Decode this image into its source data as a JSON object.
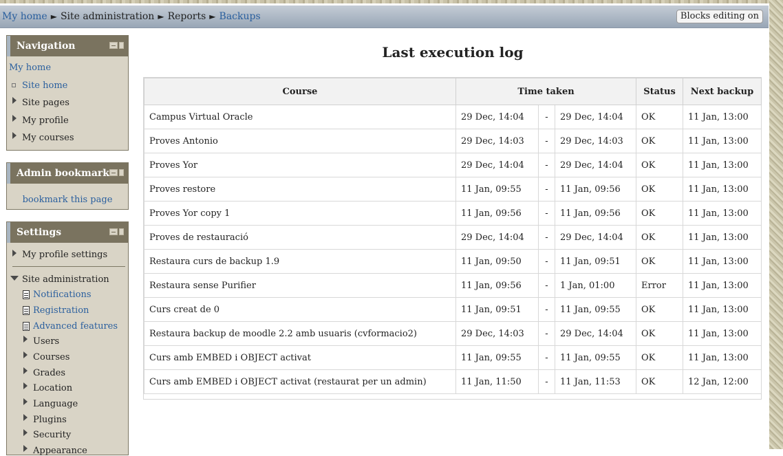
{
  "breadcrumb": {
    "home": "My home",
    "site_admin": "Site administration",
    "reports": "Reports",
    "backups": "Backups",
    "separator": "►"
  },
  "header": {
    "edit_button": "Blocks editing on"
  },
  "navigation_block": {
    "title": "Navigation",
    "my_home": "My home",
    "site_home": "Site home",
    "site_pages": "Site pages",
    "my_profile": "My profile",
    "my_courses": "My courses"
  },
  "admin_bookmarks_block": {
    "title": "Admin bookmarks",
    "bookmark_link": "bookmark this page"
  },
  "settings_block": {
    "title": "Settings",
    "my_profile_settings": "My profile settings",
    "site_administration": "Site administration",
    "notifications": "Notifications",
    "registration": "Registration",
    "advanced_features": "Advanced features",
    "users": "Users",
    "courses": "Courses",
    "grades": "Grades",
    "location": "Location",
    "language": "Language",
    "plugins": "Plugins",
    "security": "Security",
    "appearance": "Appearance"
  },
  "main": {
    "title": "Last execution log",
    "columns": {
      "course": "Course",
      "time_taken": "Time taken",
      "status": "Status",
      "next_backup": "Next backup"
    },
    "rows": [
      {
        "course": "Campus Virtual Oracle",
        "start": "29 Dec, 14:04",
        "dash": "-",
        "end": "29 Dec, 14:04",
        "status": "OK",
        "next": "11 Jan, 13:00"
      },
      {
        "course": "Proves Antonio",
        "start": "29 Dec, 14:03",
        "dash": "-",
        "end": "29 Dec, 14:03",
        "status": "OK",
        "next": "11 Jan, 13:00"
      },
      {
        "course": "Proves Yor",
        "start": "29 Dec, 14:04",
        "dash": "-",
        "end": "29 Dec, 14:04",
        "status": "OK",
        "next": "11 Jan, 13:00"
      },
      {
        "course": "Proves restore",
        "start": "11 Jan, 09:55",
        "dash": "-",
        "end": "11 Jan, 09:56",
        "status": "OK",
        "next": "11 Jan, 13:00"
      },
      {
        "course": "Proves Yor copy 1",
        "start": "11 Jan, 09:56",
        "dash": "-",
        "end": "11 Jan, 09:56",
        "status": "OK",
        "next": "11 Jan, 13:00"
      },
      {
        "course": "Proves de restauració",
        "start": "29 Dec, 14:04",
        "dash": "-",
        "end": "29 Dec, 14:04",
        "status": "OK",
        "next": "11 Jan, 13:00"
      },
      {
        "course": "Restaura curs de backup 1.9",
        "start": "11 Jan, 09:50",
        "dash": "-",
        "end": "11 Jan, 09:51",
        "status": "OK",
        "next": "11 Jan, 13:00"
      },
      {
        "course": "Restaura sense Purifier",
        "start": "11 Jan, 09:56",
        "dash": "-",
        "end": "1 Jan, 01:00",
        "status": "Error",
        "next": "11 Jan, 13:00"
      },
      {
        "course": "Curs creat de 0",
        "start": "11 Jan, 09:51",
        "dash": "-",
        "end": "11 Jan, 09:55",
        "status": "OK",
        "next": "11 Jan, 13:00"
      },
      {
        "course": "Restaura backup de moodle 2.2 amb usuaris (cvformacio2)",
        "start": "29 Dec, 14:03",
        "dash": "-",
        "end": "29 Dec, 14:04",
        "status": "OK",
        "next": "11 Jan, 13:00"
      },
      {
        "course": "Curs amb EMBED i OBJECT activat",
        "start": "11 Jan, 09:55",
        "dash": "-",
        "end": "11 Jan, 09:55",
        "status": "OK",
        "next": "11 Jan, 13:00"
      },
      {
        "course": "Curs amb EMBED i OBJECT activat (restaurat per un admin)",
        "start": "11 Jan, 11:50",
        "dash": "-",
        "end": "11 Jan, 11:53",
        "status": "OK",
        "next": "12 Jan, 12:00"
      }
    ]
  },
  "colors": {
    "ok": "#1a7a1a",
    "error": "#b30000",
    "link": "#2a5f9e",
    "block_header": "#7a735f"
  }
}
